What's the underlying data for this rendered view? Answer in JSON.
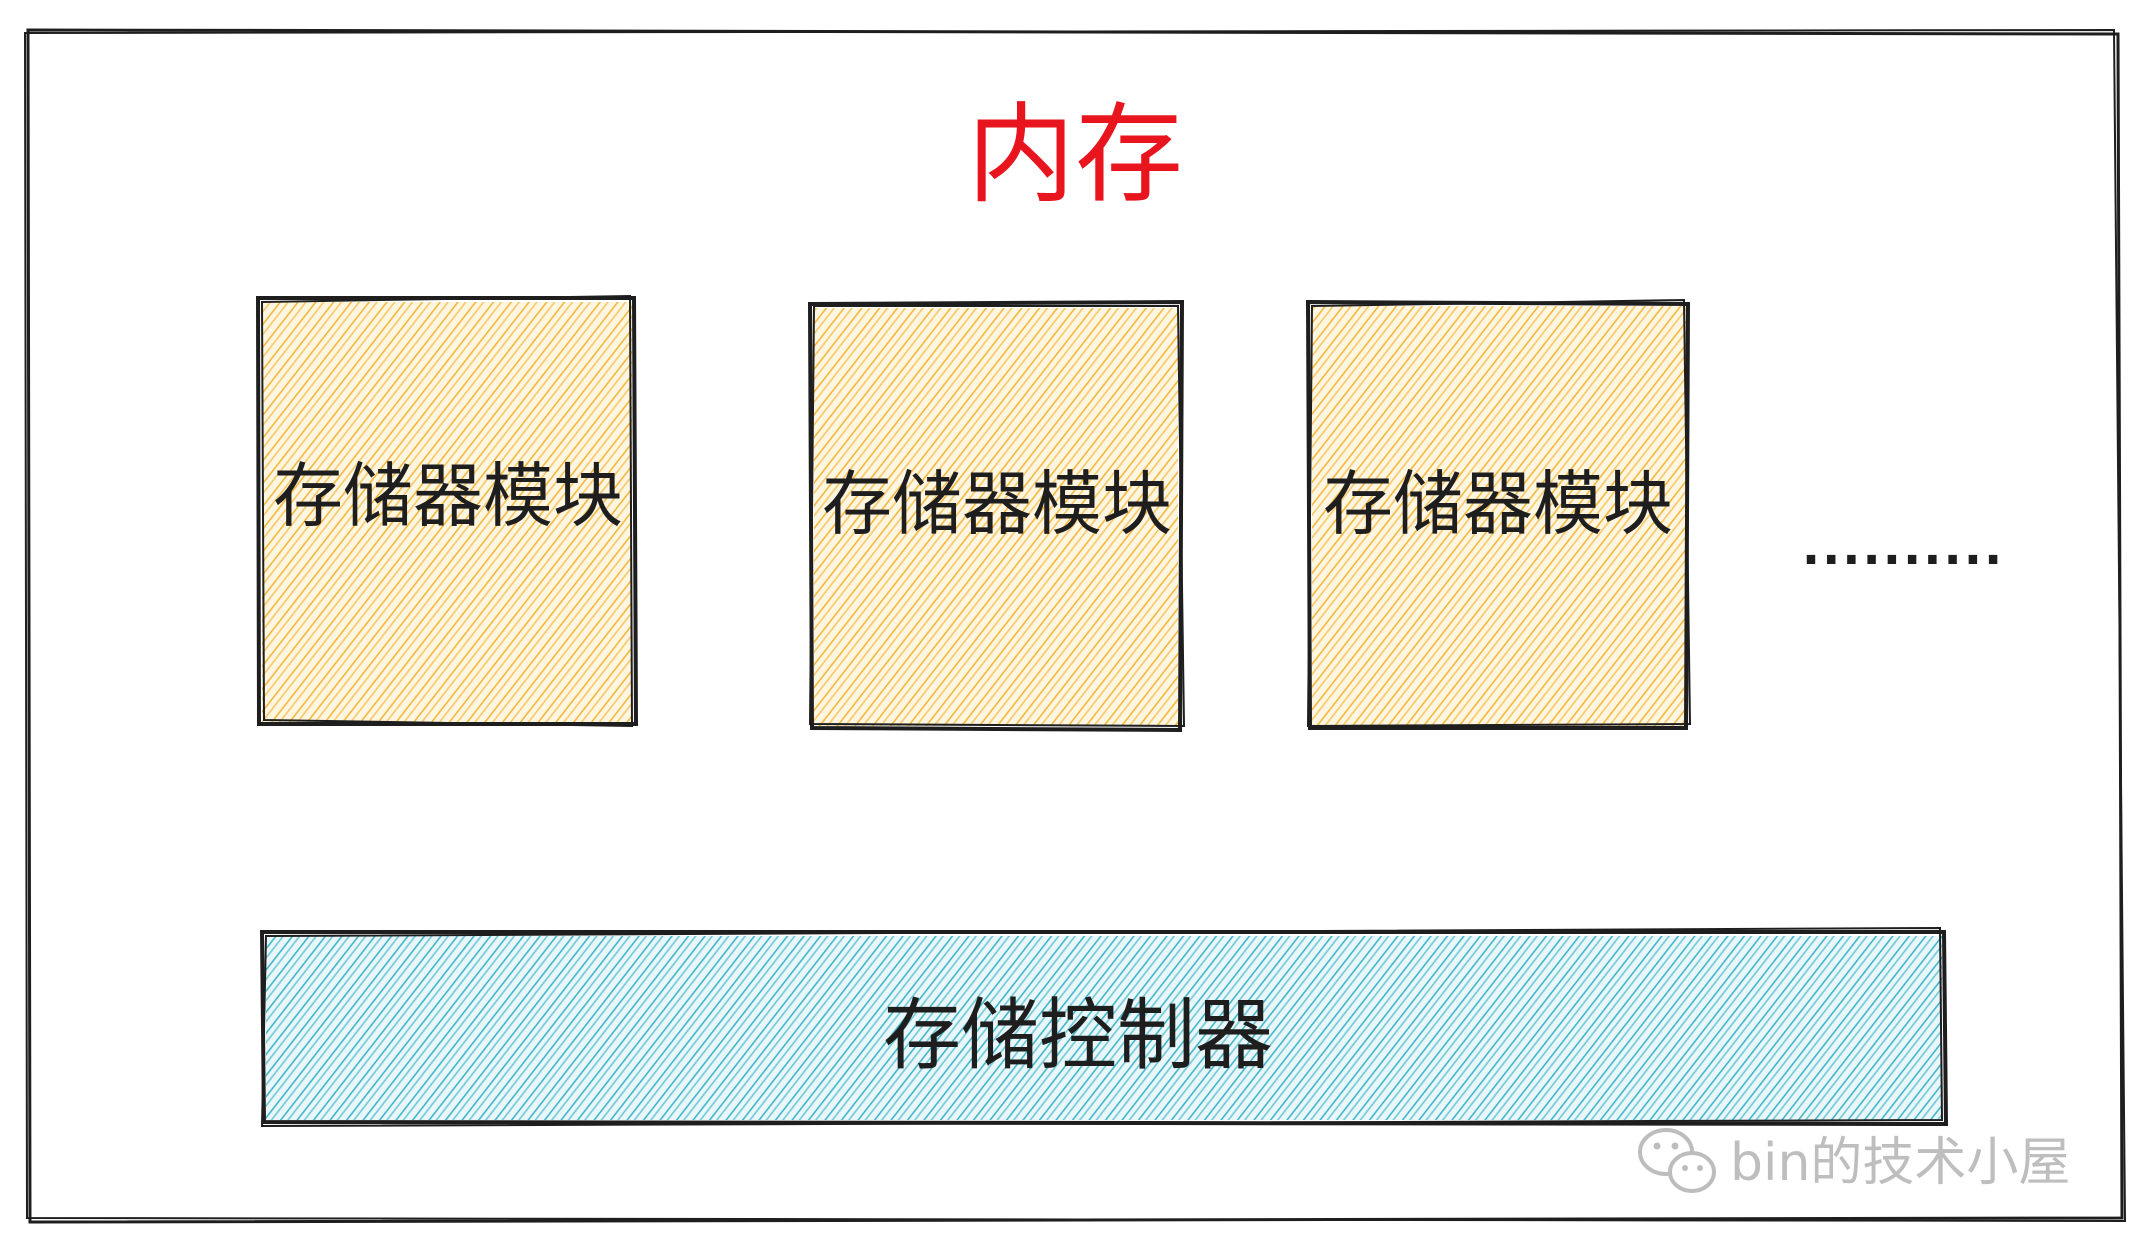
{
  "title": "内存",
  "modules": [
    {
      "label": "存储器模块"
    },
    {
      "label": "存储器模块"
    },
    {
      "label": "存储器模块"
    }
  ],
  "ellipsis": "..........",
  "controller": {
    "label": "存储控制器"
  },
  "watermark": {
    "text": "bin的技术小屋",
    "icon": "wechat-icon"
  },
  "colors": {
    "title": "#e8141e",
    "module_fill": "#f5b73b",
    "controller_fill": "#41b6c9",
    "stroke": "#1e1e1e"
  }
}
